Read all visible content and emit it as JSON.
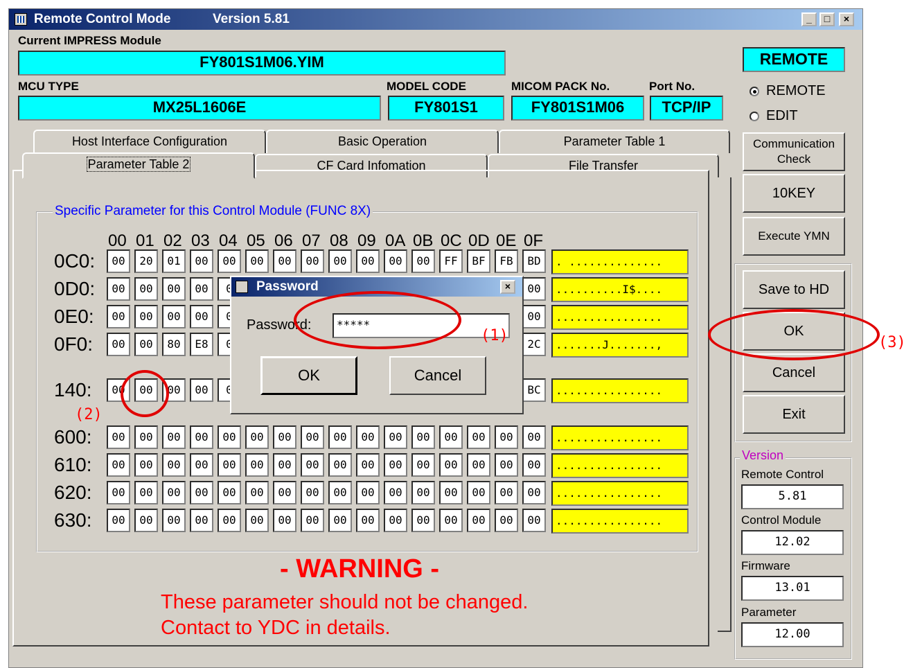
{
  "window": {
    "title": "Remote Control Mode",
    "version_label": "Version  5.81",
    "minimize": "_",
    "maximize": "□",
    "close": "×"
  },
  "module": {
    "label": "Current IMPRESS Module",
    "value": "FY801S1M06.YIM"
  },
  "mcu": {
    "label": "MCU TYPE",
    "value": "MX25L1606E"
  },
  "model": {
    "label": "MODEL CODE",
    "value": "FY801S1"
  },
  "micom": {
    "label": "MICOM PACK No.",
    "value": "FY801S1M06"
  },
  "port": {
    "label": "Port No.",
    "value": "TCP/IP"
  },
  "mode": {
    "badge": "REMOTE",
    "remote_label": "REMOTE",
    "edit_label": "EDIT"
  },
  "tabs": {
    "row1": [
      "Host Interface Configuration",
      "Basic Operation",
      "Parameter Table 1"
    ],
    "row2": [
      "Parameter Table 2",
      "CF Card Infomation",
      "File Transfer"
    ]
  },
  "group": {
    "title": "Specific Parameter for this Control Module (FUNC 8X)",
    "col_headers": [
      "00",
      "01",
      "02",
      "03",
      "04",
      "05",
      "06",
      "07",
      "08",
      "09",
      "0A",
      "0B",
      "0C",
      "0D",
      "0E",
      "0F"
    ],
    "rows": [
      {
        "label": "0C0:",
        "cells": [
          "00",
          "20",
          "01",
          "00",
          "00",
          "00",
          "00",
          "00",
          "00",
          "00",
          "00",
          "00",
          "FF",
          "BF",
          "FB",
          "BD"
        ],
        "ascii": ". .............."
      },
      {
        "label": "0D0:",
        "cells": [
          "00",
          "00",
          "00",
          "00",
          "0",
          "",
          "",
          "",
          "",
          "",
          "",
          "",
          "",
          "",
          "",
          "00"
        ],
        "ascii": "..........I$...."
      },
      {
        "label": "0E0:",
        "cells": [
          "00",
          "00",
          "00",
          "00",
          "0",
          "",
          "",
          "",
          "",
          "",
          "",
          "",
          "",
          "",
          "",
          "00"
        ],
        "ascii": "................"
      },
      {
        "label": "0F0:",
        "cells": [
          "00",
          "00",
          "80",
          "E8",
          "0",
          "",
          "",
          "",
          "",
          "",
          "",
          "",
          "",
          "",
          "",
          "2C"
        ],
        "ascii": ".......J......., "
      },
      {
        "label": "140:",
        "cells": [
          "00",
          "00",
          "00",
          "00",
          "0",
          "",
          "",
          "",
          "",
          "",
          "",
          "",
          "",
          "",
          "",
          "BC"
        ],
        "ascii": "................"
      },
      {
        "label": "600:",
        "cells": [
          "00",
          "00",
          "00",
          "00",
          "00",
          "00",
          "00",
          "00",
          "00",
          "00",
          "00",
          "00",
          "00",
          "00",
          "00",
          "00"
        ],
        "ascii": "................"
      },
      {
        "label": "610:",
        "cells": [
          "00",
          "00",
          "00",
          "00",
          "00",
          "00",
          "00",
          "00",
          "00",
          "00",
          "00",
          "00",
          "00",
          "00",
          "00",
          "00"
        ],
        "ascii": "................"
      },
      {
        "label": "620:",
        "cells": [
          "00",
          "00",
          "00",
          "00",
          "00",
          "00",
          "00",
          "00",
          "00",
          "00",
          "00",
          "00",
          "00",
          "00",
          "00",
          "00"
        ],
        "ascii": "................"
      },
      {
        "label": "630:",
        "cells": [
          "00",
          "00",
          "00",
          "00",
          "00",
          "00",
          "00",
          "00",
          "00",
          "00",
          "00",
          "00",
          "00",
          "00",
          "00",
          "00"
        ],
        "ascii": "................"
      }
    ]
  },
  "warning": {
    "title": "- WARNING -",
    "line1": "These parameter should not be changed.",
    "line2": "Contact to YDC in details."
  },
  "side_buttons": {
    "comm_check": "Communication Check",
    "tenkey": "10KEY",
    "execute_ymn": "Execute YMN",
    "save_hd": "Save to HD",
    "ok": "OK",
    "cancel": "Cancel",
    "exit": "Exit"
  },
  "version": {
    "title": "Version",
    "remote_label": "Remote Control",
    "remote_value": "5.81",
    "module_label": "Control Module",
    "module_value": "12.02",
    "firmware_label": "Firmware",
    "firmware_value": "13.01",
    "param_label": "Parameter",
    "param_value": "12.00"
  },
  "dialog": {
    "title": "Password",
    "close": "×",
    "field_label": "Password:",
    "field_value": "*****",
    "ok": "OK",
    "cancel": "Cancel"
  },
  "annotations": {
    "a1": "(1)",
    "a2": "(2)",
    "a3": "(3)"
  },
  "colors": {
    "field_cyan": "#00ffff",
    "ascii_yellow": "#ffff00",
    "warning_red": "#ff0000",
    "group_blue": "#0000ff",
    "annotation_red": "#e00000"
  }
}
